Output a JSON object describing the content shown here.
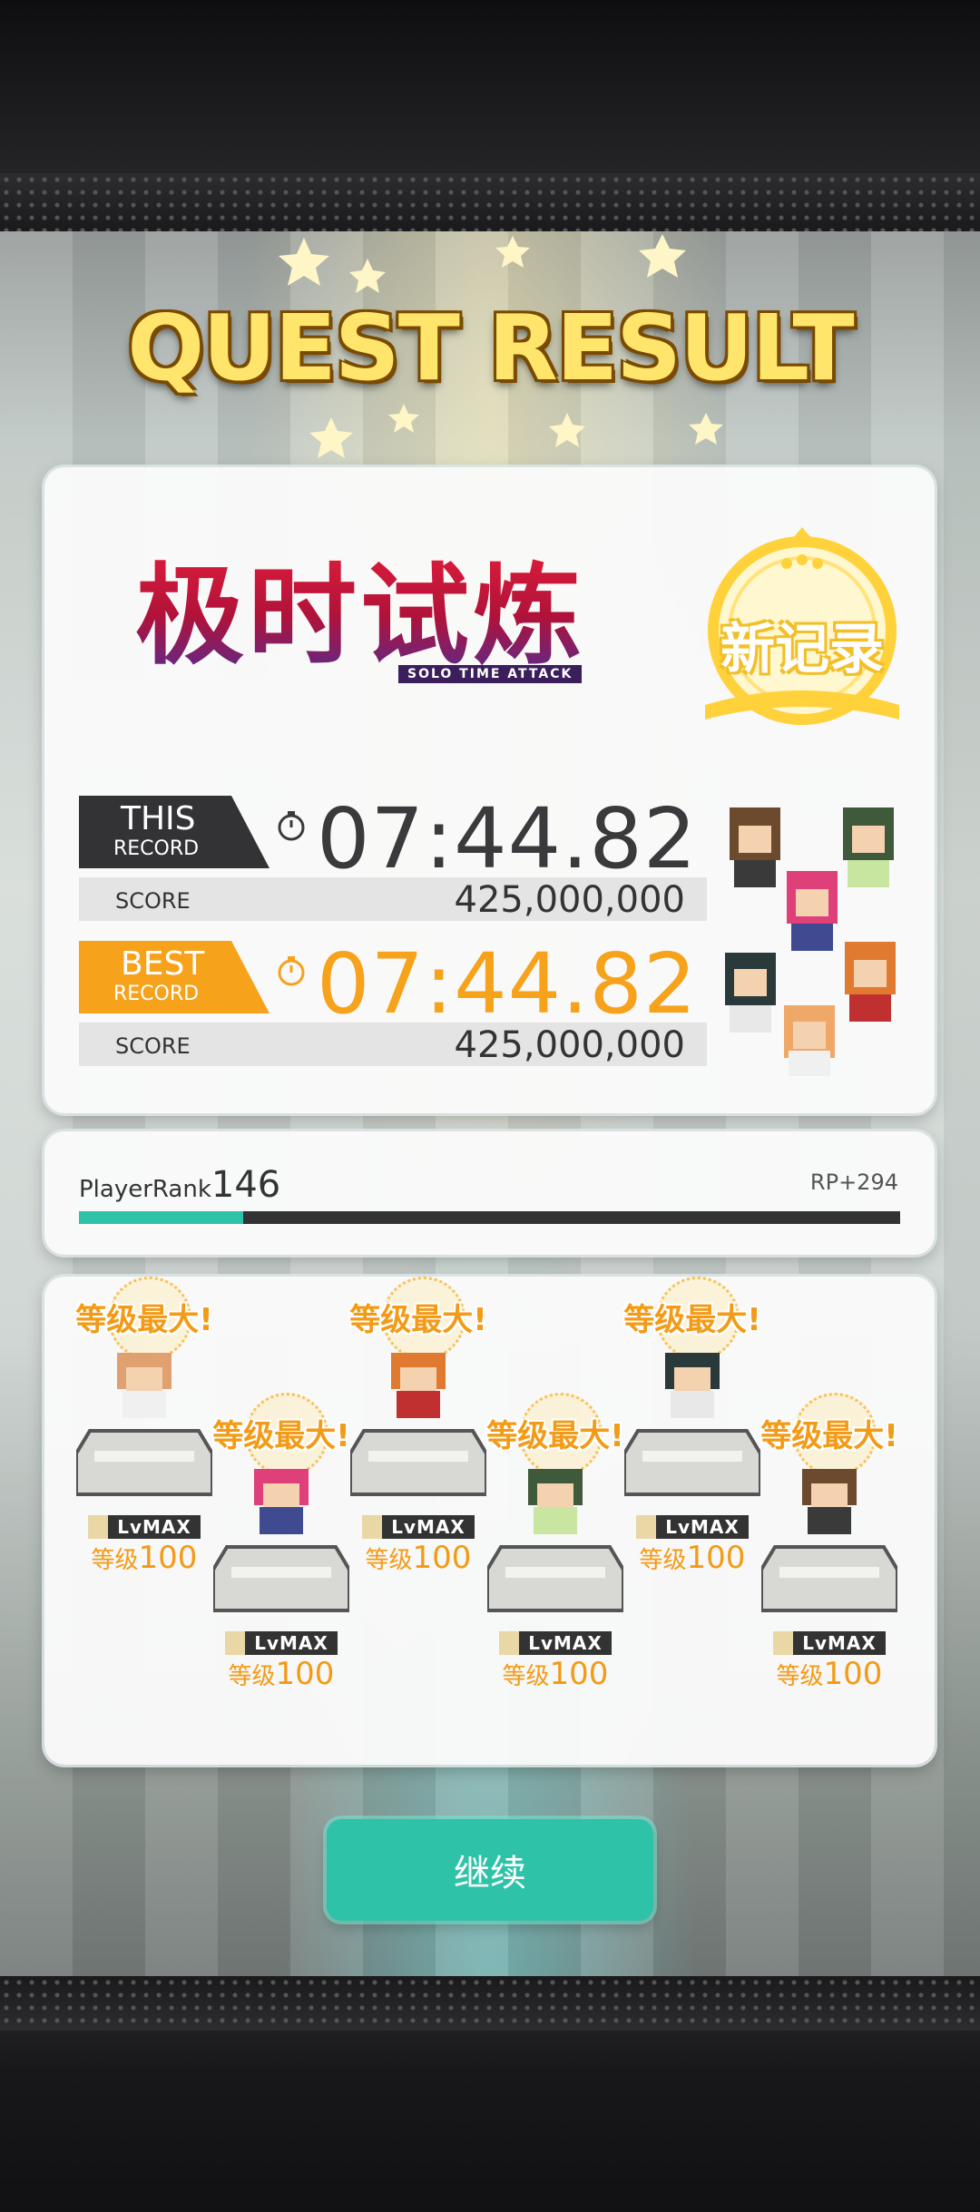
{
  "title": "QUEST RESULT",
  "mode_logo": {
    "main": "极时试炼",
    "sub": "SOLO TIME ATTACK"
  },
  "new_record_badge": "新记录",
  "this_record": {
    "tag_top": "THIS",
    "tag_bottom": "RECORD",
    "time": "07:44.82",
    "score_label": "SCORE",
    "score": "425,000,000"
  },
  "best_record": {
    "tag_top": "BEST",
    "tag_bottom": "RECORD",
    "time": "07:44.82",
    "score_label": "SCORE",
    "score": "425,000,000"
  },
  "player_rank": {
    "label": "PlayerRank",
    "value": "146",
    "rp": "RP+294",
    "progress": 0.2
  },
  "characters": [
    {
      "max_text": "等级最大!",
      "lvmax": "LvMAX",
      "level_label": "等级",
      "level": "100"
    },
    {
      "max_text": "等级最大!",
      "lvmax": "LvMAX",
      "level_label": "等级",
      "level": "100"
    },
    {
      "max_text": "等级最大!",
      "lvmax": "LvMAX",
      "level_label": "等级",
      "level": "100"
    },
    {
      "max_text": "等级最大!",
      "lvmax": "LvMAX",
      "level_label": "等级",
      "level": "100"
    },
    {
      "max_text": "等级最大!",
      "lvmax": "LvMAX",
      "level_label": "等级",
      "level": "100"
    },
    {
      "max_text": "等级最大!",
      "lvmax": "LvMAX",
      "level_label": "等级",
      "level": "100"
    }
  ],
  "continue_label": "继续",
  "colors": {
    "accent": "#2ec3a8",
    "orange": "#f6a21a",
    "dark": "#333336"
  }
}
